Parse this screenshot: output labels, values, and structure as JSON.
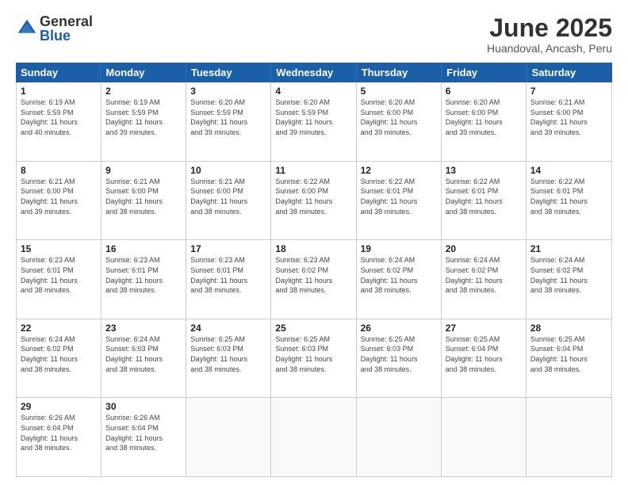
{
  "logo": {
    "general": "General",
    "blue": "Blue"
  },
  "title": "June 2025",
  "subtitle": "Huandoval, Ancash, Peru",
  "header_days": [
    "Sunday",
    "Monday",
    "Tuesday",
    "Wednesday",
    "Thursday",
    "Friday",
    "Saturday"
  ],
  "rows": [
    [
      {
        "day": "1",
        "rise": "6:19 AM",
        "set": "5:59 PM",
        "daylight": "11 hours and 40 minutes."
      },
      {
        "day": "2",
        "rise": "6:19 AM",
        "set": "5:59 PM",
        "daylight": "11 hours and 39 minutes."
      },
      {
        "day": "3",
        "rise": "6:20 AM",
        "set": "5:59 PM",
        "daylight": "11 hours and 39 minutes."
      },
      {
        "day": "4",
        "rise": "6:20 AM",
        "set": "5:59 PM",
        "daylight": "11 hours and 39 minutes."
      },
      {
        "day": "5",
        "rise": "6:20 AM",
        "set": "6:00 PM",
        "daylight": "11 hours and 39 minutes."
      },
      {
        "day": "6",
        "rise": "6:20 AM",
        "set": "6:00 PM",
        "daylight": "11 hours and 39 minutes."
      },
      {
        "day": "7",
        "rise": "6:21 AM",
        "set": "6:00 PM",
        "daylight": "11 hours and 39 minutes."
      }
    ],
    [
      {
        "day": "8",
        "rise": "6:21 AM",
        "set": "6:00 PM",
        "daylight": "11 hours and 39 minutes."
      },
      {
        "day": "9",
        "rise": "6:21 AM",
        "set": "6:00 PM",
        "daylight": "11 hours and 38 minutes."
      },
      {
        "day": "10",
        "rise": "6:21 AM",
        "set": "6:00 PM",
        "daylight": "11 hours and 38 minutes."
      },
      {
        "day": "11",
        "rise": "6:22 AM",
        "set": "6:00 PM",
        "daylight": "11 hours and 38 minutes."
      },
      {
        "day": "12",
        "rise": "6:22 AM",
        "set": "6:01 PM",
        "daylight": "11 hours and 38 minutes."
      },
      {
        "day": "13",
        "rise": "6:22 AM",
        "set": "6:01 PM",
        "daylight": "11 hours and 38 minutes."
      },
      {
        "day": "14",
        "rise": "6:22 AM",
        "set": "6:01 PM",
        "daylight": "11 hours and 38 minutes."
      }
    ],
    [
      {
        "day": "15",
        "rise": "6:23 AM",
        "set": "6:01 PM",
        "daylight": "11 hours and 38 minutes."
      },
      {
        "day": "16",
        "rise": "6:23 AM",
        "set": "6:01 PM",
        "daylight": "11 hours and 38 minutes."
      },
      {
        "day": "17",
        "rise": "6:23 AM",
        "set": "6:01 PM",
        "daylight": "11 hours and 38 minutes."
      },
      {
        "day": "18",
        "rise": "6:23 AM",
        "set": "6:02 PM",
        "daylight": "11 hours and 38 minutes."
      },
      {
        "day": "19",
        "rise": "6:24 AM",
        "set": "6:02 PM",
        "daylight": "11 hours and 38 minutes."
      },
      {
        "day": "20",
        "rise": "6:24 AM",
        "set": "6:02 PM",
        "daylight": "11 hours and 38 minutes."
      },
      {
        "day": "21",
        "rise": "6:24 AM",
        "set": "6:02 PM",
        "daylight": "11 hours and 38 minutes."
      }
    ],
    [
      {
        "day": "22",
        "rise": "6:24 AM",
        "set": "6:02 PM",
        "daylight": "11 hours and 38 minutes."
      },
      {
        "day": "23",
        "rise": "6:24 AM",
        "set": "6:03 PM",
        "daylight": "11 hours and 38 minutes."
      },
      {
        "day": "24",
        "rise": "6:25 AM",
        "set": "6:03 PM",
        "daylight": "11 hours and 38 minutes."
      },
      {
        "day": "25",
        "rise": "6:25 AM",
        "set": "6:03 PM",
        "daylight": "11 hours and 38 minutes."
      },
      {
        "day": "26",
        "rise": "6:25 AM",
        "set": "6:03 PM",
        "daylight": "11 hours and 38 minutes."
      },
      {
        "day": "27",
        "rise": "6:25 AM",
        "set": "6:04 PM",
        "daylight": "11 hours and 38 minutes."
      },
      {
        "day": "28",
        "rise": "6:25 AM",
        "set": "6:04 PM",
        "daylight": "11 hours and 38 minutes."
      }
    ],
    [
      {
        "day": "29",
        "rise": "6:26 AM",
        "set": "6:04 PM",
        "daylight": "11 hours and 38 minutes."
      },
      {
        "day": "30",
        "rise": "6:26 AM",
        "set": "6:04 PM",
        "daylight": "11 hours and 38 minutes."
      },
      null,
      null,
      null,
      null,
      null
    ]
  ],
  "labels": {
    "sunrise": "Sunrise:",
    "sunset": "Sunset:",
    "daylight": "Daylight:"
  }
}
